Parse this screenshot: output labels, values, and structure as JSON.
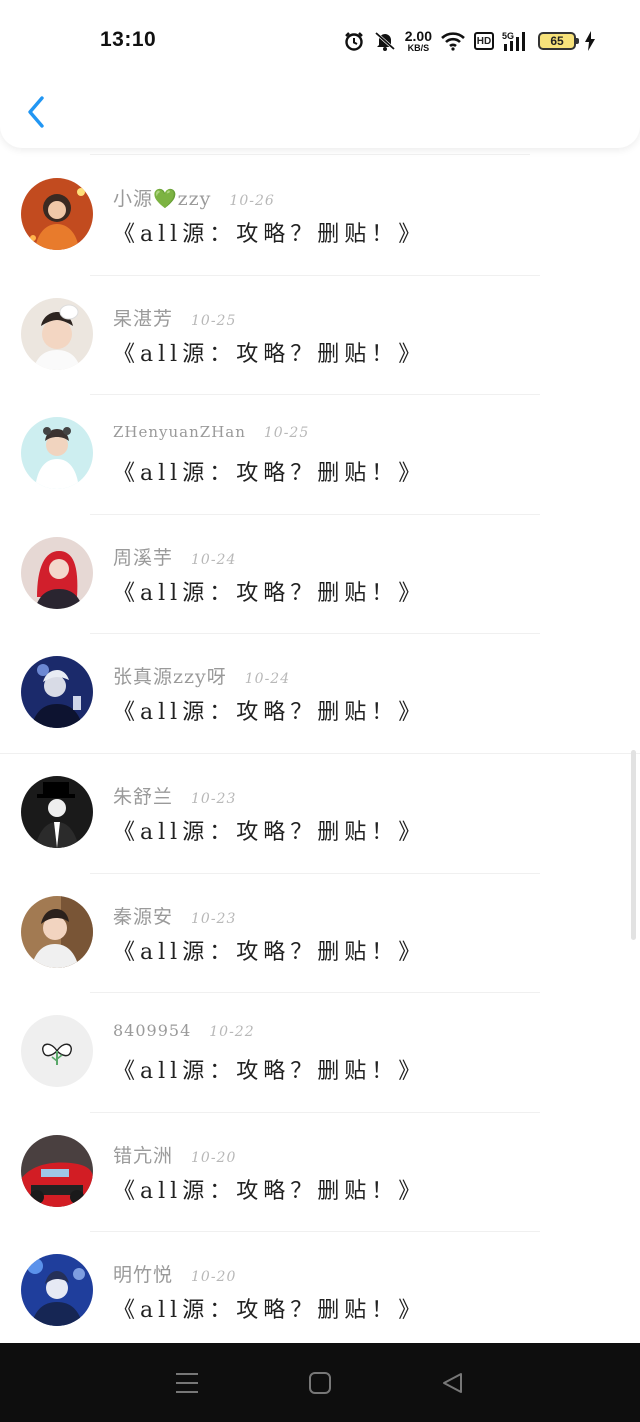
{
  "status_bar": {
    "time": "13:10",
    "speed_value": "2.00",
    "speed_unit": "KB/S",
    "hd": "HD",
    "network": "5G",
    "battery": "65",
    "icons": [
      "alarm-icon",
      "mute-icon",
      "wifi-icon",
      "signal-icon",
      "charging-icon"
    ]
  },
  "header": {
    "back_icon": "chevron-left-icon",
    "accent": "#2196f3"
  },
  "comments": [
    {
      "user": "小源💚zzy",
      "date": "10-26",
      "text": "《all源：攻略？删贴！》"
    },
    {
      "user": "杲湛芳",
      "date": "10-25",
      "text": "《all源：攻略？删贴！》"
    },
    {
      "user": "ZHenyuanZHan",
      "date": "10-25",
      "text": "《all源：攻略？删贴！》"
    },
    {
      "user": "周溪芋",
      "date": "10-24",
      "text": "《all源：攻略？删贴！》"
    },
    {
      "user": "张真源zzy呀",
      "date": "10-24",
      "text": "《all源：攻略？删贴！》"
    },
    {
      "user": "朱舒兰",
      "date": "10-23",
      "text": "《all源：攻略？删贴！》"
    },
    {
      "user": "秦源安",
      "date": "10-23",
      "text": "《all源：攻略？删贴！》"
    },
    {
      "user": "8409954",
      "date": "10-22",
      "text": "《all源：攻略？删贴！》"
    },
    {
      "user": "错亢洲",
      "date": "10-20",
      "text": "《all源：攻略？删贴！》"
    },
    {
      "user": "明竹悦",
      "date": "10-20",
      "text": "《all源：攻略？删贴！》"
    }
  ],
  "nav": {
    "icons": [
      "menu-icon",
      "home-icon",
      "back-icon"
    ]
  }
}
